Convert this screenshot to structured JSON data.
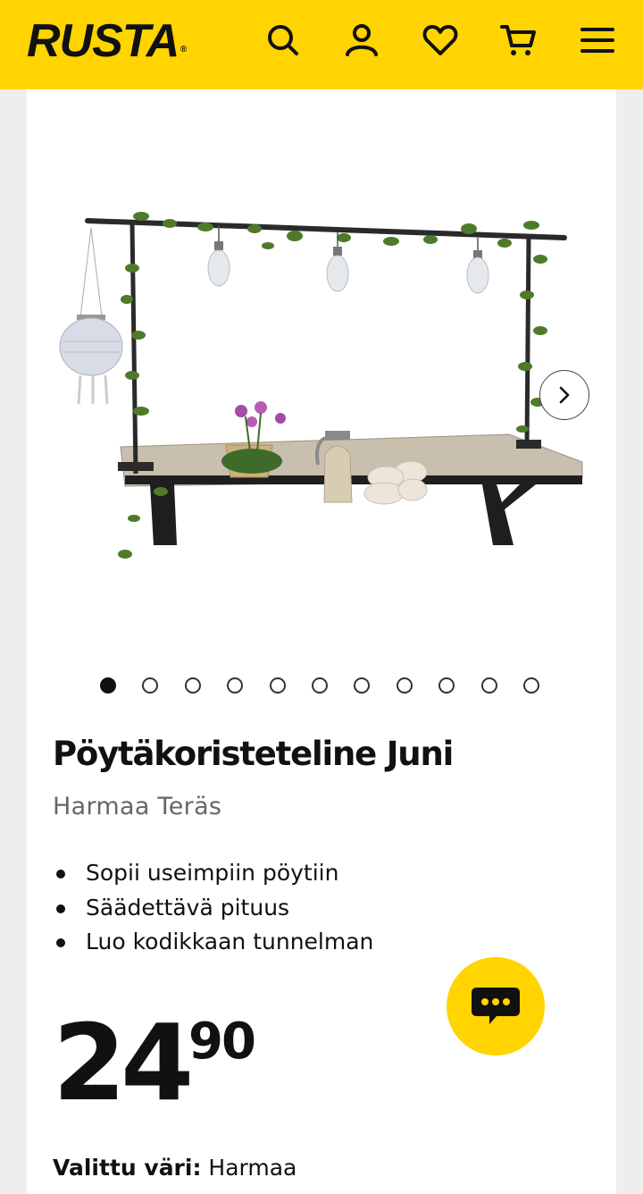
{
  "header": {
    "logo": "RUSTA",
    "logo_mark": "®",
    "icons": [
      "search-icon",
      "user-icon",
      "heart-icon",
      "cart-icon",
      "menu-icon"
    ],
    "background": "#ffd400"
  },
  "product": {
    "title": "Pöytäkoristeteline Juni",
    "subtitle": "Harmaa Teräs",
    "features": [
      "Sopii useimpiin pöytiin",
      "Säädettävä pituus",
      "Luo kodikkaan tunnelman"
    ],
    "price_integer": "24",
    "price_decimal": "90",
    "color_label": "Valittu väri:",
    "color_value": "Harmaa"
  },
  "gallery": {
    "image_count": 11,
    "active_index": 0
  },
  "accent_color": "#ffd400"
}
